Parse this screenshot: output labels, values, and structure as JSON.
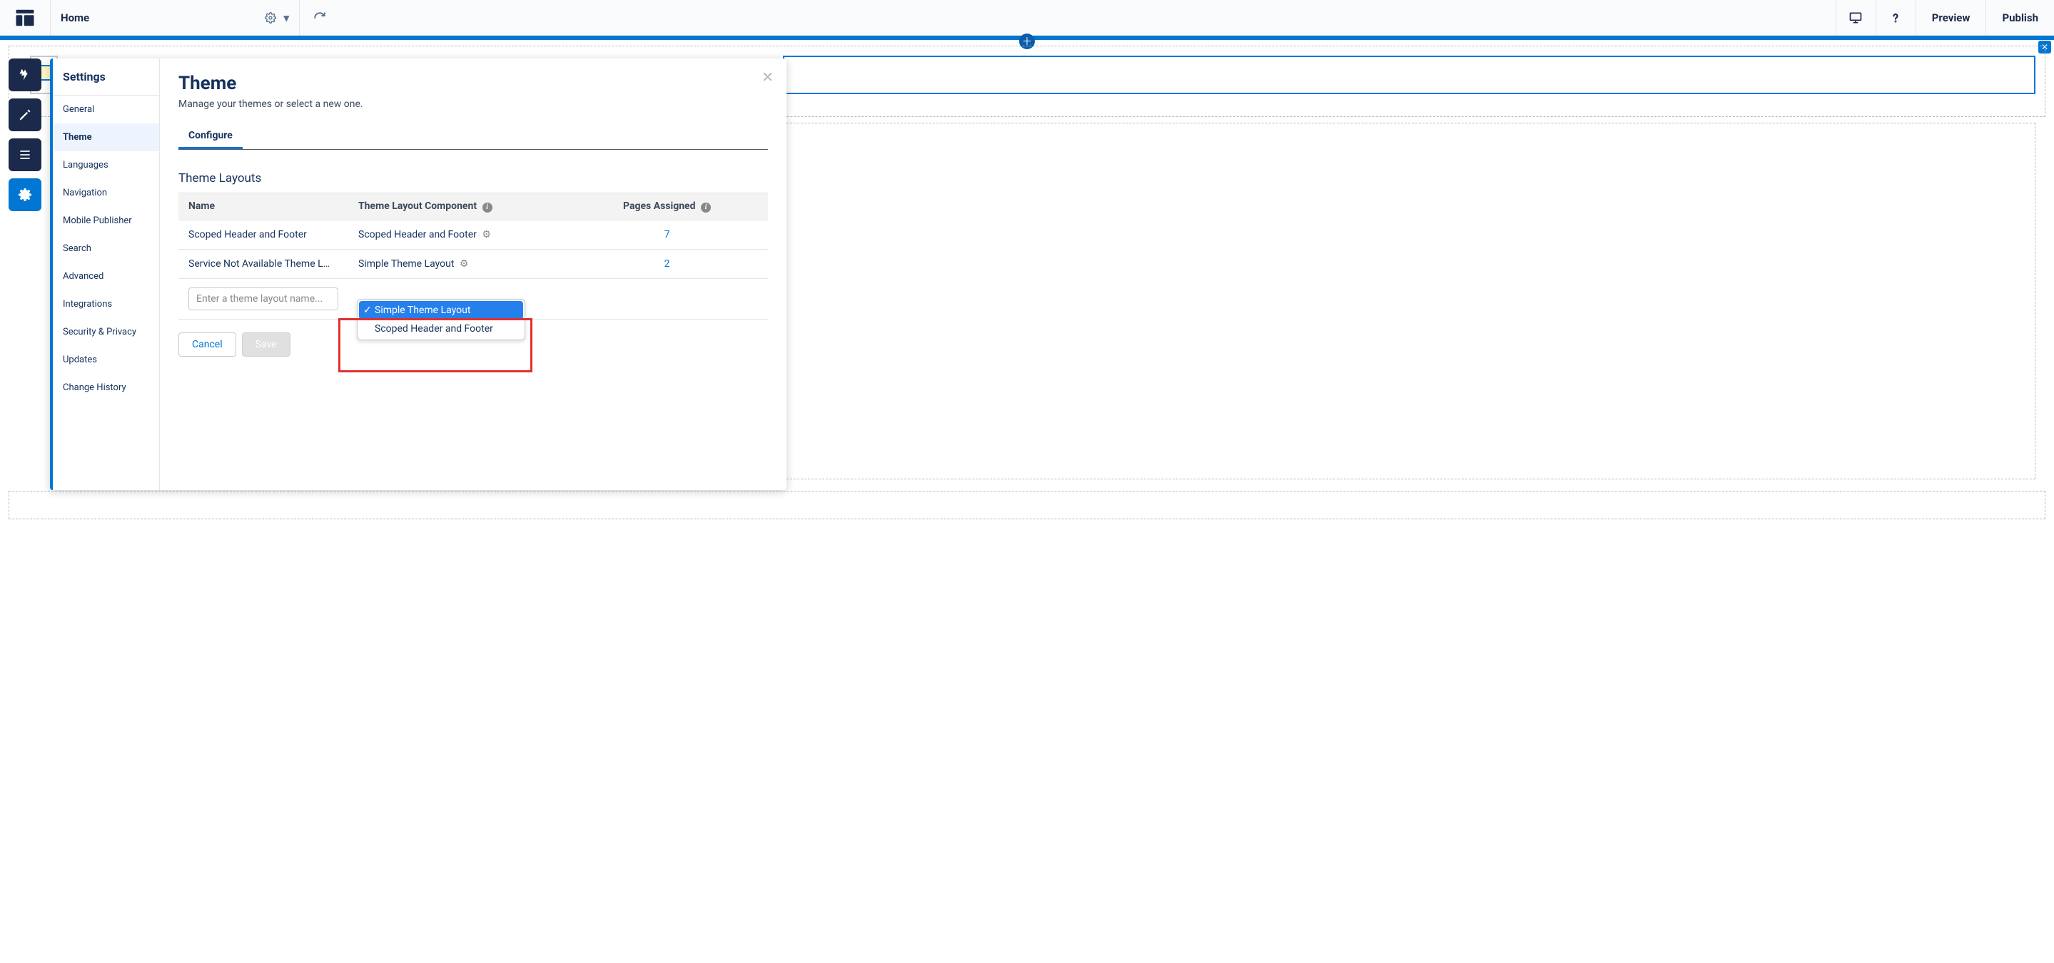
{
  "toolbar": {
    "home_label": "Home",
    "preview_label": "Preview",
    "publish_label": "Publish"
  },
  "settings": {
    "sidebar_title": "Settings",
    "nav": [
      "General",
      "Theme",
      "Languages",
      "Navigation",
      "Mobile Publisher",
      "Search",
      "Advanced",
      "Integrations",
      "Security & Privacy",
      "Updates",
      "Change History"
    ],
    "active_nav_index": 1,
    "panel_title": "Theme",
    "panel_subtitle": "Manage your themes or select a new one.",
    "tab_label": "Configure",
    "section_title": "Theme Layouts",
    "table": {
      "headers": {
        "name": "Name",
        "component": "Theme Layout Component",
        "pages": "Pages Assigned"
      },
      "rows": [
        {
          "name": "Scoped Header and Footer",
          "component": "Scoped Header and Footer",
          "pages": "7"
        },
        {
          "name": "Service Not Available Theme L…",
          "component": "Simple Theme Layout",
          "pages": "2"
        }
      ],
      "new_row_placeholder": "Enter a theme layout name...",
      "dropdown_options": [
        "Simple Theme Layout",
        "Scoped Header and Footer"
      ],
      "dropdown_selected_index": 0
    },
    "buttons": {
      "cancel": "Cancel",
      "save": "Save"
    }
  }
}
